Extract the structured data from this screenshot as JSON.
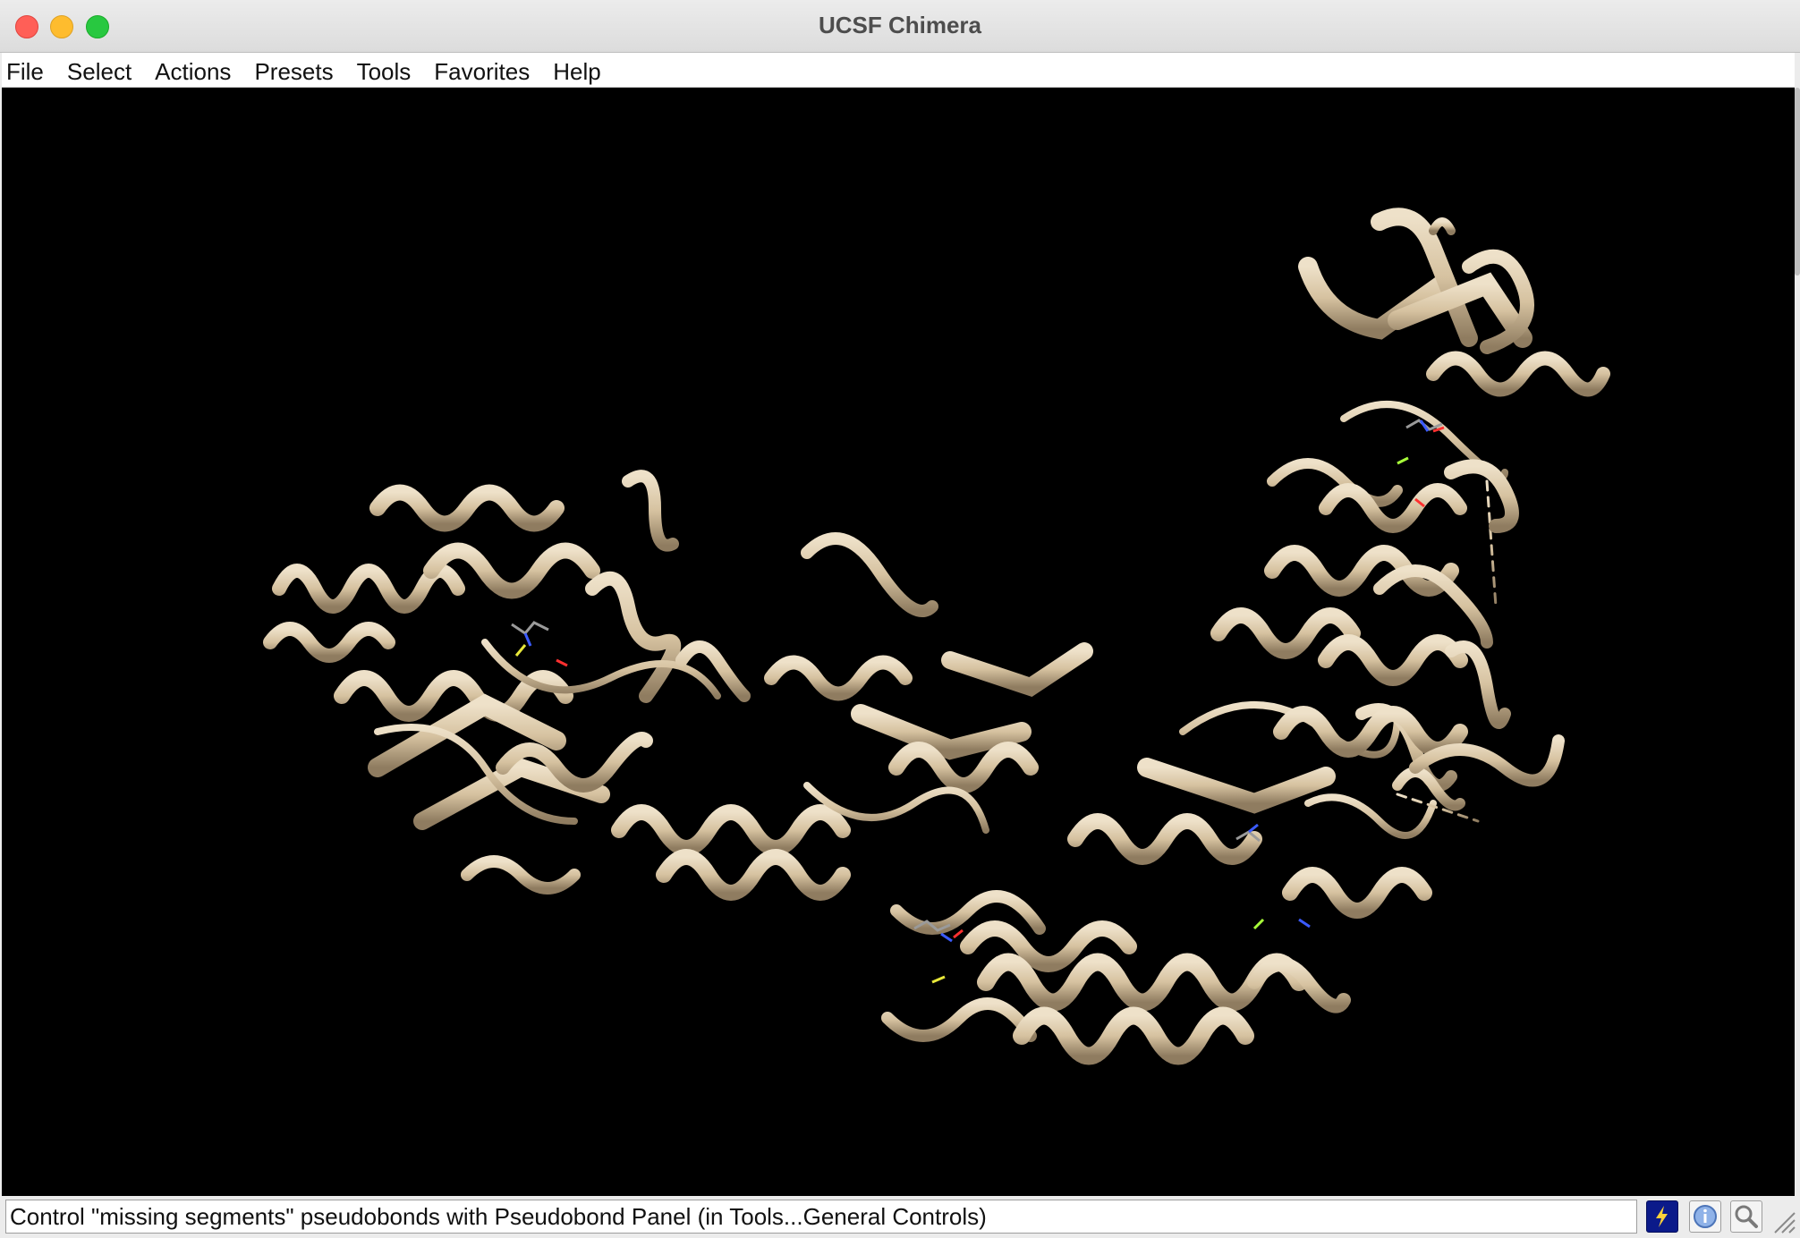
{
  "window": {
    "title": "UCSF Chimera"
  },
  "menubar": {
    "items": [
      {
        "label": "File"
      },
      {
        "label": "Select"
      },
      {
        "label": "Actions"
      },
      {
        "label": "Presets"
      },
      {
        "label": "Tools"
      },
      {
        "label": "Favorites"
      },
      {
        "label": "Help"
      }
    ]
  },
  "viewport": {
    "background": "#000000",
    "ribbon_color": "#d9c7a8",
    "description_icon": "protein-ribbon-structure"
  },
  "statusbar": {
    "message": "Control \"missing segments\" pseudobonds with Pseudobond Panel (in Tools...General Controls)",
    "buttons": [
      {
        "icon": "lightning-icon",
        "name": "command-line-button"
      },
      {
        "icon": "info-icon",
        "name": "info-button"
      },
      {
        "icon": "magnifier-icon",
        "name": "zoom-button"
      }
    ]
  }
}
